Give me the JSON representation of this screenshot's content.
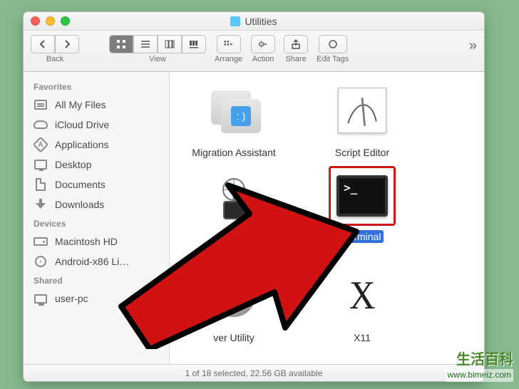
{
  "window": {
    "title": "Utilities"
  },
  "toolbar": {
    "back_label": "Back",
    "view_label": "View",
    "arrange_label": "Arrange",
    "action_label": "Action",
    "share_label": "Share",
    "edittags_label": "Edit Tags"
  },
  "sidebar": {
    "sections": [
      {
        "title": "Favorites",
        "items": [
          {
            "label": "All My Files",
            "icon": "allfiles"
          },
          {
            "label": "iCloud Drive",
            "icon": "cloud"
          },
          {
            "label": "Applications",
            "icon": "app"
          },
          {
            "label": "Desktop",
            "icon": "desktop"
          },
          {
            "label": "Documents",
            "icon": "doc"
          },
          {
            "label": "Downloads",
            "icon": "dl"
          }
        ]
      },
      {
        "title": "Devices",
        "items": [
          {
            "label": "Macintosh HD",
            "icon": "hd"
          },
          {
            "label": "Android-x86 Li…",
            "icon": "cd"
          }
        ]
      },
      {
        "title": "Shared",
        "items": [
          {
            "label": "user-pc",
            "icon": "mon"
          }
        ]
      }
    ]
  },
  "apps": {
    "migration": "Migration Assistant",
    "scripteditor": "Script Editor",
    "systeminfo": "",
    "terminal": "Terminal",
    "voiceover": "ver Utility",
    "x11": "X11"
  },
  "status": "1 of 18 selected, 22.56 GB available",
  "watermark": {
    "cn": "生活百科",
    "url": "www.bimeiz.com"
  }
}
